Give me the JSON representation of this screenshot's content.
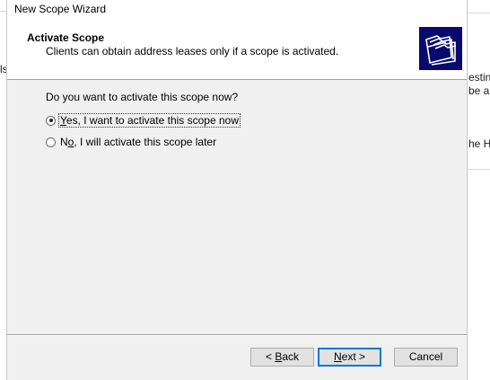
{
  "window": {
    "title": "New Scope Wizard"
  },
  "header": {
    "title": "Activate Scope",
    "subtitle": "Clients can obtain address leases only if a scope is activated.",
    "icon": "folders-icon"
  },
  "content": {
    "question": "Do you want to activate this scope now?",
    "options": [
      {
        "label_pre": "",
        "accel": "Y",
        "label_post": "es, I want to activate this scope now",
        "checked": true
      },
      {
        "label_pre": "N",
        "accel": "o",
        "label_post": ", I will activate this scope later",
        "checked": false
      }
    ]
  },
  "buttons": {
    "back": {
      "pre": "< ",
      "accel": "B",
      "post": "ack"
    },
    "next": {
      "pre": "",
      "accel": "N",
      "post": "ext >"
    },
    "cancel": "Cancel"
  },
  "background": {
    "left_text": "ls",
    "right_text_1": "esting",
    "right_text_2": "be as",
    "right_text_3": "he He"
  }
}
